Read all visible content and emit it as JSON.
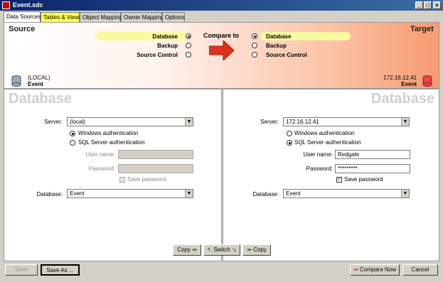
{
  "window": {
    "title": "Event.sdc",
    "minimize": "_",
    "maximize": "□",
    "close": "×"
  },
  "tabs": [
    {
      "label": "Data Sources"
    },
    {
      "label": "Tables & Views"
    },
    {
      "label": "Object Mapping"
    },
    {
      "label": "Owner Mapping"
    },
    {
      "label": "Options"
    }
  ],
  "header": {
    "source_title": "Source",
    "target_title": "Target",
    "compare_to": "Compare to",
    "left_options": [
      "Database",
      "Backup",
      "Source Control"
    ],
    "right_options": [
      "Database",
      "Backup",
      "Source Control"
    ],
    "left_selected": "Database",
    "right_selected": "Database",
    "source_server": "(LOCAL)",
    "source_db": "Event",
    "target_server": "172.16.12.41",
    "target_db": "Event"
  },
  "left_panel": {
    "heading": "Database",
    "server_label": "Server:",
    "server_value": "(local)",
    "auth_windows": "Windows authentication",
    "auth_sql": "SQL Server authentication",
    "auth_selected": "windows",
    "username_label": "User name:",
    "username_value": "",
    "password_label": "Password:",
    "password_value": "",
    "save_password_label": "Save password",
    "save_password_checked": false,
    "database_label": "Database:",
    "database_value": "Event"
  },
  "right_panel": {
    "heading": "Database",
    "server_label": "Server:",
    "server_value": "172.16.12.41",
    "auth_windows": "Windows authentication",
    "auth_sql": "SQL Server authentication",
    "auth_selected": "sql",
    "username_label": "User name:",
    "username_value": "Redgate",
    "password_label": "Password:",
    "password_value": "*********",
    "save_password_label": "Save password",
    "save_password_checked": true,
    "database_label": "Database:",
    "database_value": "Event"
  },
  "copy_bar": {
    "copy_right": "Copy",
    "switch": "Switch",
    "copy_left": "Copy"
  },
  "footer": {
    "save": "Save",
    "save_as": "Save As ...",
    "compare_now": "Compare Now",
    "cancel": "Cancel"
  },
  "colors": {
    "titlebar": "#0a246a",
    "header_gradient_end": "#f79b72",
    "highlight": "#fafaa0",
    "arrow_red": "#e03020"
  }
}
